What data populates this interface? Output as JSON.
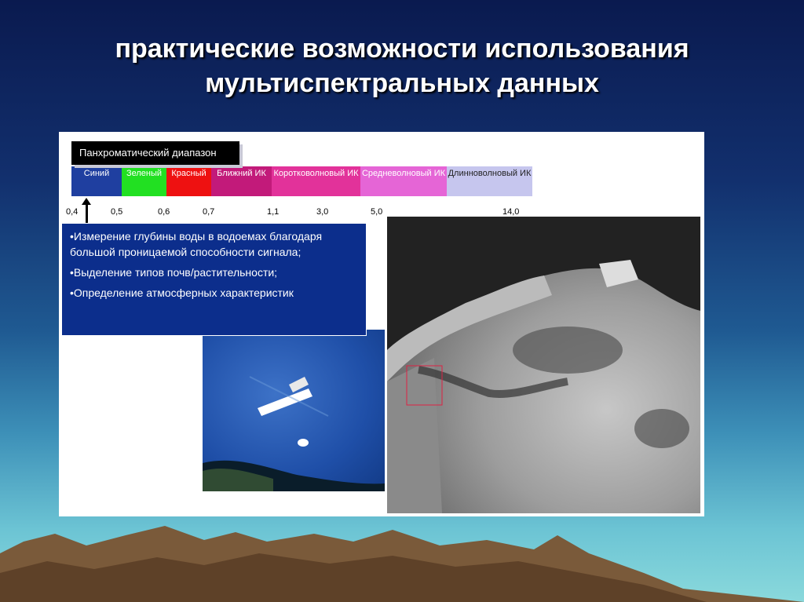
{
  "title": {
    "line1": "практические возможности использования",
    "line2": "мультиспектральных данных"
  },
  "pan_label": "Панхроматический диапазон",
  "bands": [
    {
      "label": "Синий",
      "color": "#1f3fa0"
    },
    {
      "label": "Зеленый",
      "color": "#22e022"
    },
    {
      "label": "Красный",
      "color": "#ee1111"
    },
    {
      "label": "Ближний ИК",
      "color": "#c21a7a"
    },
    {
      "label": "Коротковолновый ИК",
      "color": "#e2329a"
    },
    {
      "label": "Средневолновый ИК",
      "color": "#e565d6"
    },
    {
      "label": "Длинноволновый ИК",
      "color": "#c6c6ee"
    }
  ],
  "ticks": [
    "0,4",
    "0,5",
    "0,6",
    "0,7",
    "1,1",
    "3,0",
    "5,0",
    "14,0"
  ],
  "bullets": [
    "•Измерение глубины воды в водоемах благодаря большой проницаемой способности сигнала;",
    "•Выделение типов почв/растительности;",
    "•Определение атмосферных характеристик"
  ]
}
